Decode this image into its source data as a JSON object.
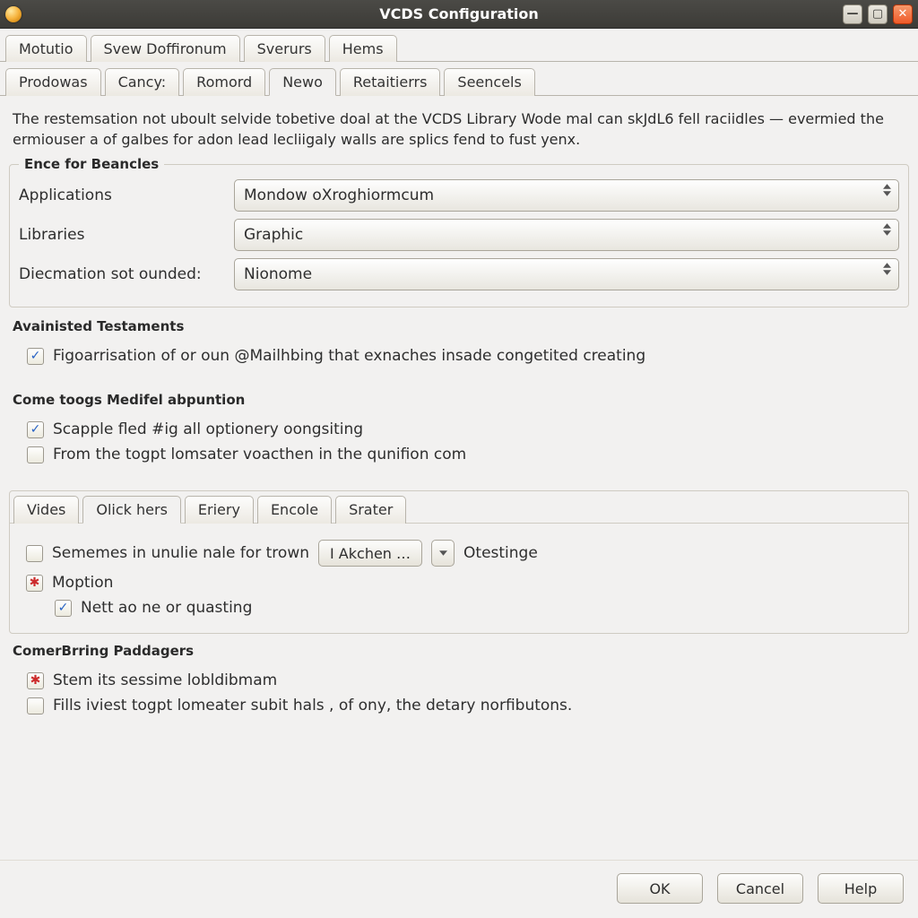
{
  "window": {
    "title": "VCDS Configuration"
  },
  "top_tabs": [
    {
      "label": "Motutio"
    },
    {
      "label": "Svew Doffironum"
    },
    {
      "label": "Sverurs"
    },
    {
      "label": "Hems"
    }
  ],
  "sub_tabs": [
    {
      "label": "Prodowas"
    },
    {
      "label": "Cancy:"
    },
    {
      "label": "Romord"
    },
    {
      "label": "Newo",
      "active": true
    },
    {
      "label": "Retaitierrs"
    },
    {
      "label": "Seencels"
    }
  ],
  "description": "The restemsation not uboult selvide tobetive doal at the VCDS Library Wode mal can skJdL6 fell raciidles — evermied the ermiouser a of galbes for adon lead lecliigaly walls are splics fend to fust yenx.",
  "group1": {
    "title": "Ence for Beancles",
    "rows": [
      {
        "label": "Applications",
        "value": "Mondow oXroghiormcum"
      },
      {
        "label": "Libraries",
        "value": "Graphic"
      },
      {
        "label": "Diecmation sot ounded:",
        "value": "Nionome"
      }
    ]
  },
  "group2": {
    "title": "Avainisted Testaments",
    "check": {
      "label": "Figoarrisation of or oun @Mailhbing that exnaches insade congetited creating",
      "checked": true
    }
  },
  "group3": {
    "title": "Come toogs Medifel abpuntion",
    "checks": [
      {
        "label": "Scapple fled #ig all optionery oongsiting",
        "checked": true
      },
      {
        "label": "From the togpt lomsater voacthen in the qunifion com",
        "checked": false
      }
    ]
  },
  "inner_tabs": [
    {
      "label": "Vides"
    },
    {
      "label": "Olick hers",
      "active": true
    },
    {
      "label": "Eriery"
    },
    {
      "label": "Encole"
    },
    {
      "label": "Srater"
    }
  ],
  "inner": {
    "row1": {
      "check_label": "Sememes in unulie nale for trown",
      "button": "I Akchen …",
      "tail": "Otestinge"
    },
    "row2": {
      "label": "Moption",
      "mark": "red"
    },
    "row2_sub": {
      "label": "Nett ao ne or quasting",
      "checked": true
    }
  },
  "group4": {
    "title": "ComerBrring Paddagers",
    "checks": [
      {
        "label": "Stem its sessime lobldibmam",
        "mark": "red"
      },
      {
        "label": "Fills iviest togpt lomeater subit hals , of ony, the detary norfibutons.",
        "checked": false
      }
    ]
  },
  "footer": {
    "ok": "OK",
    "cancel": "Cancel",
    "help": "Help"
  }
}
